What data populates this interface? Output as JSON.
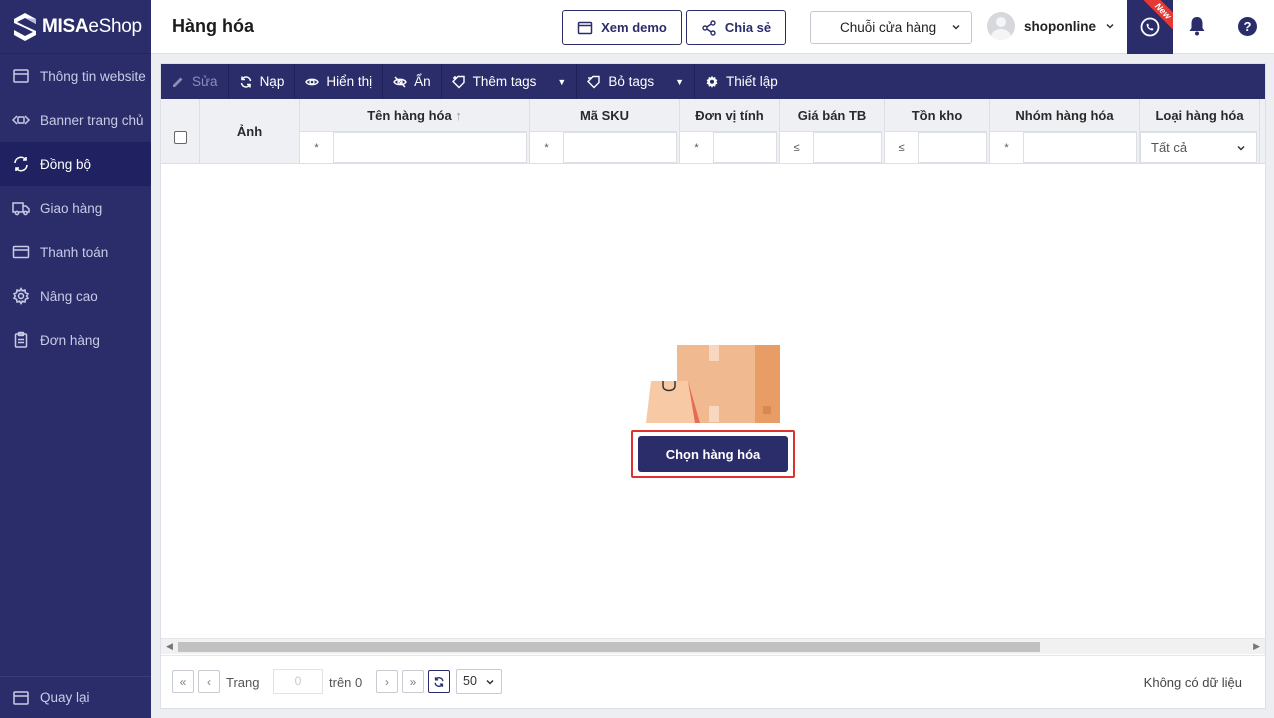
{
  "app": {
    "logo_text_bold": "MISA",
    "logo_text_rest": "eShop"
  },
  "sidebar": {
    "items": [
      {
        "label": "Thông tin website",
        "icon": "window-icon",
        "active": false
      },
      {
        "label": "Banner trang chủ",
        "icon": "banner-icon",
        "active": false
      },
      {
        "label": "Đồng bộ",
        "icon": "sync-icon",
        "active": true
      },
      {
        "label": "Giao hàng",
        "icon": "truck-icon",
        "active": false
      },
      {
        "label": "Thanh toán",
        "icon": "card-icon",
        "active": false
      },
      {
        "label": "Nâng cao",
        "icon": "gear-icon",
        "active": false
      },
      {
        "label": "Đơn hàng",
        "icon": "clipboard-icon",
        "active": false
      }
    ],
    "back_label": "Quay lại"
  },
  "header": {
    "title": "Hàng hóa",
    "demo_label": "Xem demo",
    "share_label": "Chia sẻ",
    "store_select": "Chuỗi cửa hàng",
    "username": "shoponline",
    "new_badge": "New",
    "help_label": "?"
  },
  "toolbar": {
    "edit": "Sửa",
    "reload": "Nạp",
    "show": "Hiển thị",
    "hide": "Ẩn",
    "add_tags": "Thêm tags",
    "remove_tags": "Bỏ tags",
    "settings": "Thiết lập"
  },
  "grid": {
    "columns": {
      "image": "Ảnh",
      "name": "Tên hàng hóa",
      "sku": "Mã SKU",
      "unit": "Đơn vị tính",
      "price": "Giá bán TB",
      "stock": "Tồn kho",
      "group": "Nhóm hàng hóa",
      "type": "Loại hàng hóa"
    },
    "filter_ops": {
      "name": "*",
      "sku": "*",
      "unit": "*",
      "price": "≤",
      "stock": "≤",
      "group": "*"
    },
    "type_filter_value": "Tất cả"
  },
  "empty_state": {
    "button_label": "Chọn hàng hóa"
  },
  "pager": {
    "page_label": "Trang",
    "page_value": "0",
    "of_label": "trên 0",
    "page_size": "50",
    "status": "Không có dữ liệu"
  },
  "colors": {
    "primary": "#2b2d6b",
    "highlight": "#e03131",
    "box": "#f0b98f"
  }
}
